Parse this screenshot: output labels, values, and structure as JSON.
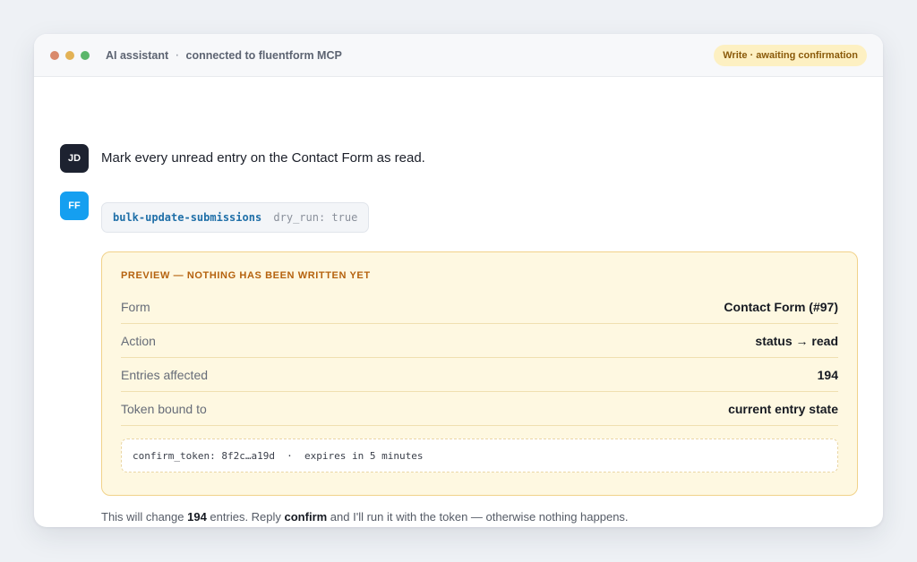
{
  "window": {
    "title": "AI assistant",
    "separator": "·",
    "connection": "connected to fluentform MCP",
    "status_pill": "Write · awaiting confirmation",
    "traffic_lights": [
      "#d9896b",
      "#e3b255",
      "#5bb66a"
    ]
  },
  "user": {
    "initials": "JD",
    "avatar_color": "#1d2230",
    "message": "Mark every unread entry on the Contact Form as read."
  },
  "assistant": {
    "initials": "FF",
    "avatar_color": "#159ff0",
    "tool_call": {
      "name": "bulk-update-submissions",
      "args": "dry_run: true"
    }
  },
  "preview": {
    "title": "PREVIEW — NOTHING HAS BEEN WRITTEN YET",
    "rows": [
      {
        "label": "Form",
        "value": "Contact Form (#97)"
      },
      {
        "label": "Action",
        "value": "status → read"
      },
      {
        "label": "Entries affected",
        "value": "194"
      },
      {
        "label": "Token bound to",
        "value": "current entry state"
      }
    ],
    "token": "confirm_token: 8f2c…a19d  ·  expires in 5 minutes"
  },
  "footer": {
    "part1": "This will change ",
    "count": "194",
    "part2": " entries. Reply ",
    "keyword": "confirm",
    "part3": " and I'll run it with the token — otherwise nothing happens."
  }
}
